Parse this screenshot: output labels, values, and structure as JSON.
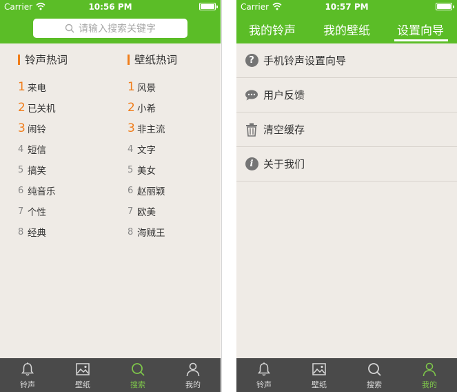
{
  "left": {
    "status": {
      "carrier": "Carrier",
      "time": "10:56 PM"
    },
    "search": {
      "placeholder": "请输入搜索关键字"
    },
    "ringtone_col": {
      "title": "铃声热词",
      "items": [
        {
          "rank": "1",
          "label": "来电"
        },
        {
          "rank": "2",
          "label": "已关机"
        },
        {
          "rank": "3",
          "label": "闹铃"
        },
        {
          "rank": "4",
          "label": "短信"
        },
        {
          "rank": "5",
          "label": "搞笑"
        },
        {
          "rank": "6",
          "label": "纯音乐"
        },
        {
          "rank": "7",
          "label": "个性"
        },
        {
          "rank": "8",
          "label": "经典"
        }
      ]
    },
    "wallpaper_col": {
      "title": "壁纸热词",
      "items": [
        {
          "rank": "1",
          "label": "风景"
        },
        {
          "rank": "2",
          "label": "小希"
        },
        {
          "rank": "3",
          "label": "非主流"
        },
        {
          "rank": "4",
          "label": "文字"
        },
        {
          "rank": "5",
          "label": "美女"
        },
        {
          "rank": "6",
          "label": "赵丽颖"
        },
        {
          "rank": "7",
          "label": "欧美"
        },
        {
          "rank": "8",
          "label": "海贼王"
        }
      ]
    },
    "tabbar": [
      {
        "label": "铃声",
        "icon": "bell-icon"
      },
      {
        "label": "壁纸",
        "icon": "image-icon"
      },
      {
        "label": "搜索",
        "icon": "search-icon"
      },
      {
        "label": "我的",
        "icon": "person-icon"
      }
    ],
    "active_tab": 2
  },
  "right": {
    "status": {
      "carrier": "Carrier",
      "time": "10:57 PM"
    },
    "tabs": [
      "我的铃声",
      "我的壁纸",
      "设置向导"
    ],
    "active_tab": 2,
    "menu": [
      {
        "label": "手机铃声设置向导",
        "icon": "question-icon"
      },
      {
        "label": "用户反馈",
        "icon": "chat-bubble-icon"
      },
      {
        "label": "清空缓存",
        "icon": "trash-icon"
      },
      {
        "label": "关于我们",
        "icon": "info-icon"
      }
    ],
    "tabbar": [
      {
        "label": "铃声",
        "icon": "bell-icon"
      },
      {
        "label": "壁纸",
        "icon": "image-icon"
      },
      {
        "label": "搜索",
        "icon": "search-icon"
      },
      {
        "label": "我的",
        "icon": "person-icon"
      }
    ],
    "active_tab_bottom": 3
  },
  "colors": {
    "brand_green": "#5bbd27",
    "accent_orange": "#f07d1a",
    "background": "#efebe6",
    "tabbar_bg": "#4a4a4a",
    "tabbar_active": "#7ec64a"
  }
}
